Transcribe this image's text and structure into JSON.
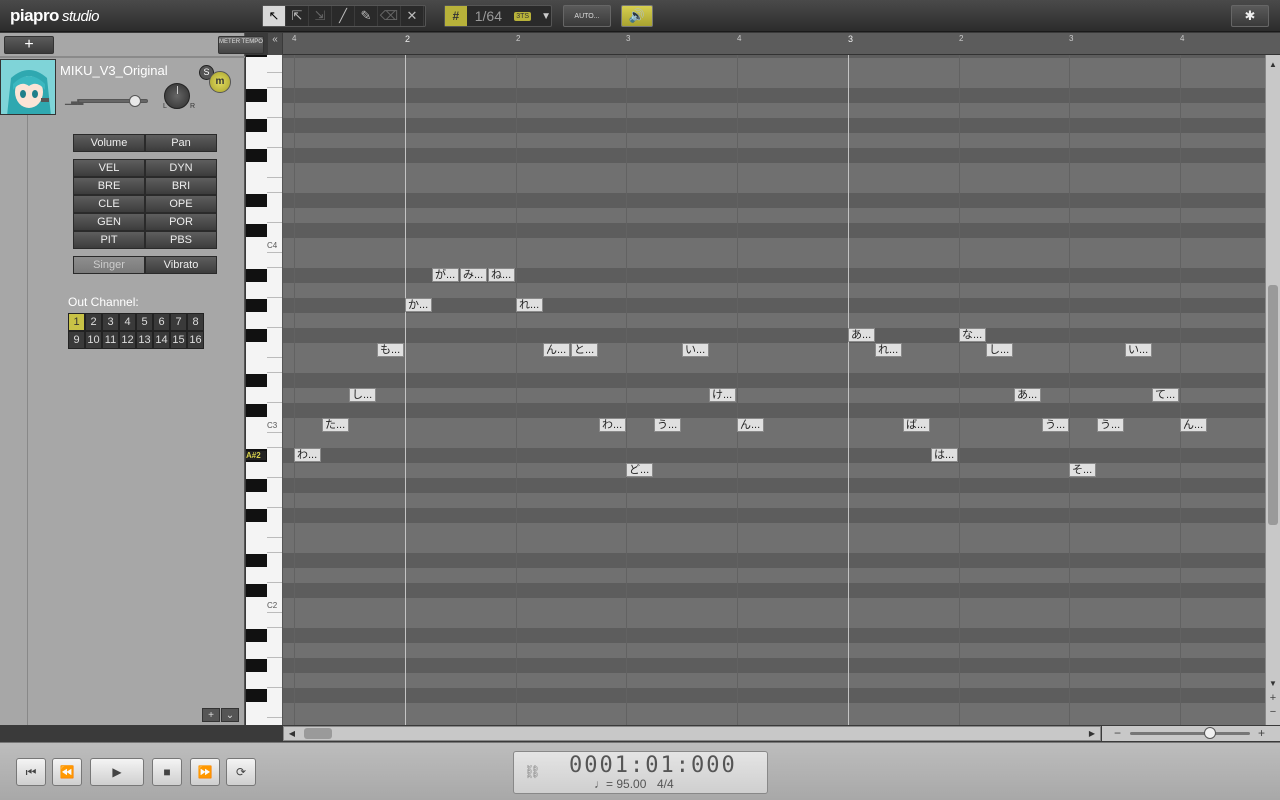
{
  "app": {
    "logo_main": "piapro",
    "logo_sub": "studio"
  },
  "toolbar": {
    "tools": [
      {
        "name": "select-tool",
        "glyph": "↖",
        "active": true
      },
      {
        "name": "range-select-tool",
        "glyph": "⇱"
      },
      {
        "name": "stretch-tool",
        "glyph": "⇲",
        "dim": true
      },
      {
        "name": "line-tool",
        "glyph": "╱"
      },
      {
        "name": "pencil-tool",
        "glyph": "✎"
      },
      {
        "name": "eraser-tool",
        "glyph": "⌫",
        "dim": true
      },
      {
        "name": "delete-tool",
        "glyph": "✕"
      }
    ],
    "quantize": "1/64",
    "triplet_label": "3TS",
    "auto_label": "AUTO...",
    "meter_label": "METER TEMPO",
    "collapse_label": "«"
  },
  "track": {
    "singer_name": "MIKU_V3_Original",
    "solo_label": "S",
    "mute_label": "m",
    "pan_left": "L",
    "pan_right": "R",
    "volume_label": "Volume",
    "pan_label": "Pan",
    "params": [
      "VEL",
      "DYN",
      "BRE",
      "BRI",
      "CLE",
      "OPE",
      "GEN",
      "POR",
      "PIT",
      "PBS"
    ],
    "singer_btn": "Singer",
    "vibrato_btn": "Vibrato",
    "out_channel_label": "Out Channel:",
    "channels": [
      "1",
      "2",
      "3",
      "4",
      "5",
      "6",
      "7",
      "8",
      "9",
      "10",
      "11",
      "12",
      "13",
      "14",
      "15",
      "16"
    ],
    "active_channel": "1"
  },
  "ruler": {
    "labels": [
      {
        "text": "4",
        "bar": false
      },
      {
        "text": "2",
        "bar": true
      },
      {
        "text": "2",
        "bar": false
      },
      {
        "text": "3",
        "bar": false
      },
      {
        "text": "4",
        "bar": false
      },
      {
        "text": "3",
        "bar": true
      },
      {
        "text": "2",
        "bar": false
      },
      {
        "text": "3",
        "bar": false
      },
      {
        "text": "4",
        "bar": false
      }
    ]
  },
  "keyboard": {
    "labels": [
      "C4",
      "C3",
      "A#2",
      "C2"
    ],
    "highlight": "A#2"
  },
  "notes": [
    {
      "lyric": "わ...",
      "pitch": "A#2",
      "beat": 1.0,
      "len": 0.25
    },
    {
      "lyric": "た...",
      "pitch": "C3",
      "beat": 1.25,
      "len": 0.25
    },
    {
      "lyric": "し...",
      "pitch": "D3",
      "beat": 1.5,
      "len": 0.25
    },
    {
      "lyric": "も...",
      "pitch": "F3",
      "beat": 1.75,
      "len": 0.25
    },
    {
      "lyric": "か...",
      "pitch": "G#3",
      "beat": 2.0,
      "len": 0.25
    },
    {
      "lyric": "が...",
      "pitch": "A#3",
      "beat": 2.25,
      "len": 0.25
    },
    {
      "lyric": "み...",
      "pitch": "A#3",
      "beat": 2.5,
      "len": 0.25
    },
    {
      "lyric": "ね...",
      "pitch": "A#3",
      "beat": 2.75,
      "len": 0.25
    },
    {
      "lyric": "れ...",
      "pitch": "G#3",
      "beat": 3.0,
      "len": 0.25
    },
    {
      "lyric": "ん...",
      "pitch": "F3",
      "beat": 3.25,
      "len": 0.25
    },
    {
      "lyric": "と...",
      "pitch": "F3",
      "beat": 3.5,
      "len": 0.25
    },
    {
      "lyric": "わ...",
      "pitch": "C3",
      "beat": 3.75,
      "len": 0.25
    },
    {
      "lyric": "ど...",
      "pitch": "A2",
      "beat": 4.0,
      "len": 0.25
    },
    {
      "lyric": "う...",
      "pitch": "C3",
      "beat": 4.25,
      "len": 0.25
    },
    {
      "lyric": "い...",
      "pitch": "F3",
      "beat": 4.5,
      "len": 0.25
    },
    {
      "lyric": "け...",
      "pitch": "D3",
      "beat": 4.75,
      "len": 0.25
    },
    {
      "lyric": "ん...",
      "pitch": "C3",
      "beat": 5.0,
      "len": 0.25
    },
    {
      "lyric": "あ...",
      "pitch": "F#3",
      "beat": 6.0,
      "len": 0.25
    },
    {
      "lyric": "れ...",
      "pitch": "F3",
      "beat": 6.25,
      "len": 0.25
    },
    {
      "lyric": "ば...",
      "pitch": "C3",
      "beat": 6.5,
      "len": 0.25
    },
    {
      "lyric": "は...",
      "pitch": "A#2",
      "beat": 6.75,
      "len": 0.25
    },
    {
      "lyric": "な...",
      "pitch": "F#3",
      "beat": 7.0,
      "len": 0.25
    },
    {
      "lyric": "し...",
      "pitch": "F3",
      "beat": 7.25,
      "len": 0.25
    },
    {
      "lyric": "あ...",
      "pitch": "D3",
      "beat": 7.5,
      "len": 0.25
    },
    {
      "lyric": "う...",
      "pitch": "C3",
      "beat": 7.75,
      "len": 0.25
    },
    {
      "lyric": "そ...",
      "pitch": "A2",
      "beat": 8.0,
      "len": 0.25
    },
    {
      "lyric": "う...",
      "pitch": "C3",
      "beat": 8.25,
      "len": 0.25
    },
    {
      "lyric": "い...",
      "pitch": "F3",
      "beat": 8.5,
      "len": 0.25
    },
    {
      "lyric": "て...",
      "pitch": "D3",
      "beat": 8.75,
      "len": 0.25
    },
    {
      "lyric": "ん...",
      "pitch": "C3",
      "beat": 9.0,
      "len": 0.25
    }
  ],
  "transport": {
    "time": "0001:01:000",
    "tempo": "♩= 95.00",
    "signature": "4/4",
    "buttons": [
      {
        "name": "go-to-start-button",
        "glyph": "⏮"
      },
      {
        "name": "rewind-button",
        "glyph": "⏪"
      },
      {
        "name": "play-button",
        "glyph": "▶"
      },
      {
        "name": "stop-button",
        "glyph": "■"
      },
      {
        "name": "fast-forward-button",
        "glyph": "⏩"
      },
      {
        "name": "loop-button",
        "glyph": "⟳"
      }
    ]
  },
  "colors": {
    "accent": "#c8c246",
    "roll_bg": "#686868"
  }
}
